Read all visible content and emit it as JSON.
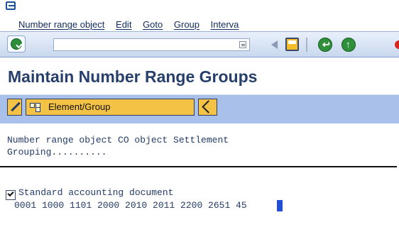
{
  "menu": {
    "items": [
      "Number range object",
      "Edit",
      "Goto",
      "Group",
      "Interva"
    ]
  },
  "toolbar": {
    "command_field_value": "",
    "icons": [
      "check-icon",
      "dropdown-icon",
      "back-triangle-icon",
      "save-icon",
      "back-icon",
      "exit-icon",
      "cancel-icon"
    ]
  },
  "title": "Maintain Number Range Groups",
  "app_toolbar": {
    "element_group_label": "Element/Group"
  },
  "content": {
    "object_line1": "Number range object CO object Settlement",
    "object_line2": "Grouping..........",
    "group_label": "Standard accounting document",
    "group_checked": true,
    "numbers_line": "0001 1000 1101 2000 2010 2011 2200 2651 45"
  },
  "colors": {
    "title": "#263f6b",
    "menu_text": "#102b5e",
    "app_toolbar_bg": "#a9c1ea",
    "button_gold": "#f4c346",
    "green_action": "#2c8d3a",
    "cancel_red": "#d62620"
  }
}
